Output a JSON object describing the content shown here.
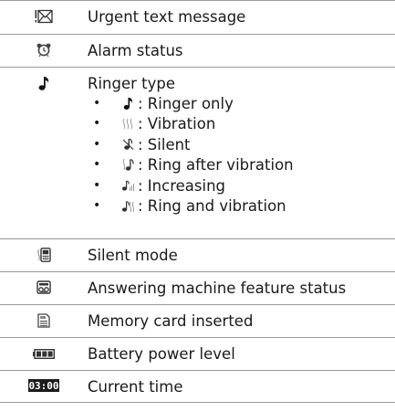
{
  "rows": [
    {
      "icon": "urgent-message-icon",
      "label": "Urgent text message"
    },
    {
      "icon": "alarm-clock-icon",
      "label": "Alarm status"
    },
    {
      "icon": "music-note-icon",
      "label": "Ringer type",
      "items": [
        {
          "icon": "music-note-icon",
          "text": ": Ringer only"
        },
        {
          "icon": "vibration-icon",
          "text": ": Vibration"
        },
        {
          "icon": "silent-note-icon",
          "text": ": Silent"
        },
        {
          "icon": "ring-after-vibration-icon",
          "text": ": Ring after vibration"
        },
        {
          "icon": "increasing-ring-icon",
          "text": ": Increasing"
        },
        {
          "icon": "ring-and-vibration-icon",
          "text": ": Ring and vibration"
        }
      ]
    },
    {
      "icon": "silent-mode-phone-icon",
      "label": "Silent mode"
    },
    {
      "icon": "answering-machine-icon",
      "label": "Answering machine feature status"
    },
    {
      "icon": "memory-card-icon",
      "label": "Memory card inserted"
    },
    {
      "icon": "battery-icon",
      "label": "Battery power level"
    },
    {
      "icon": "clock-display-icon",
      "label": "Current time",
      "display": "03:00"
    }
  ],
  "bullet": "•"
}
